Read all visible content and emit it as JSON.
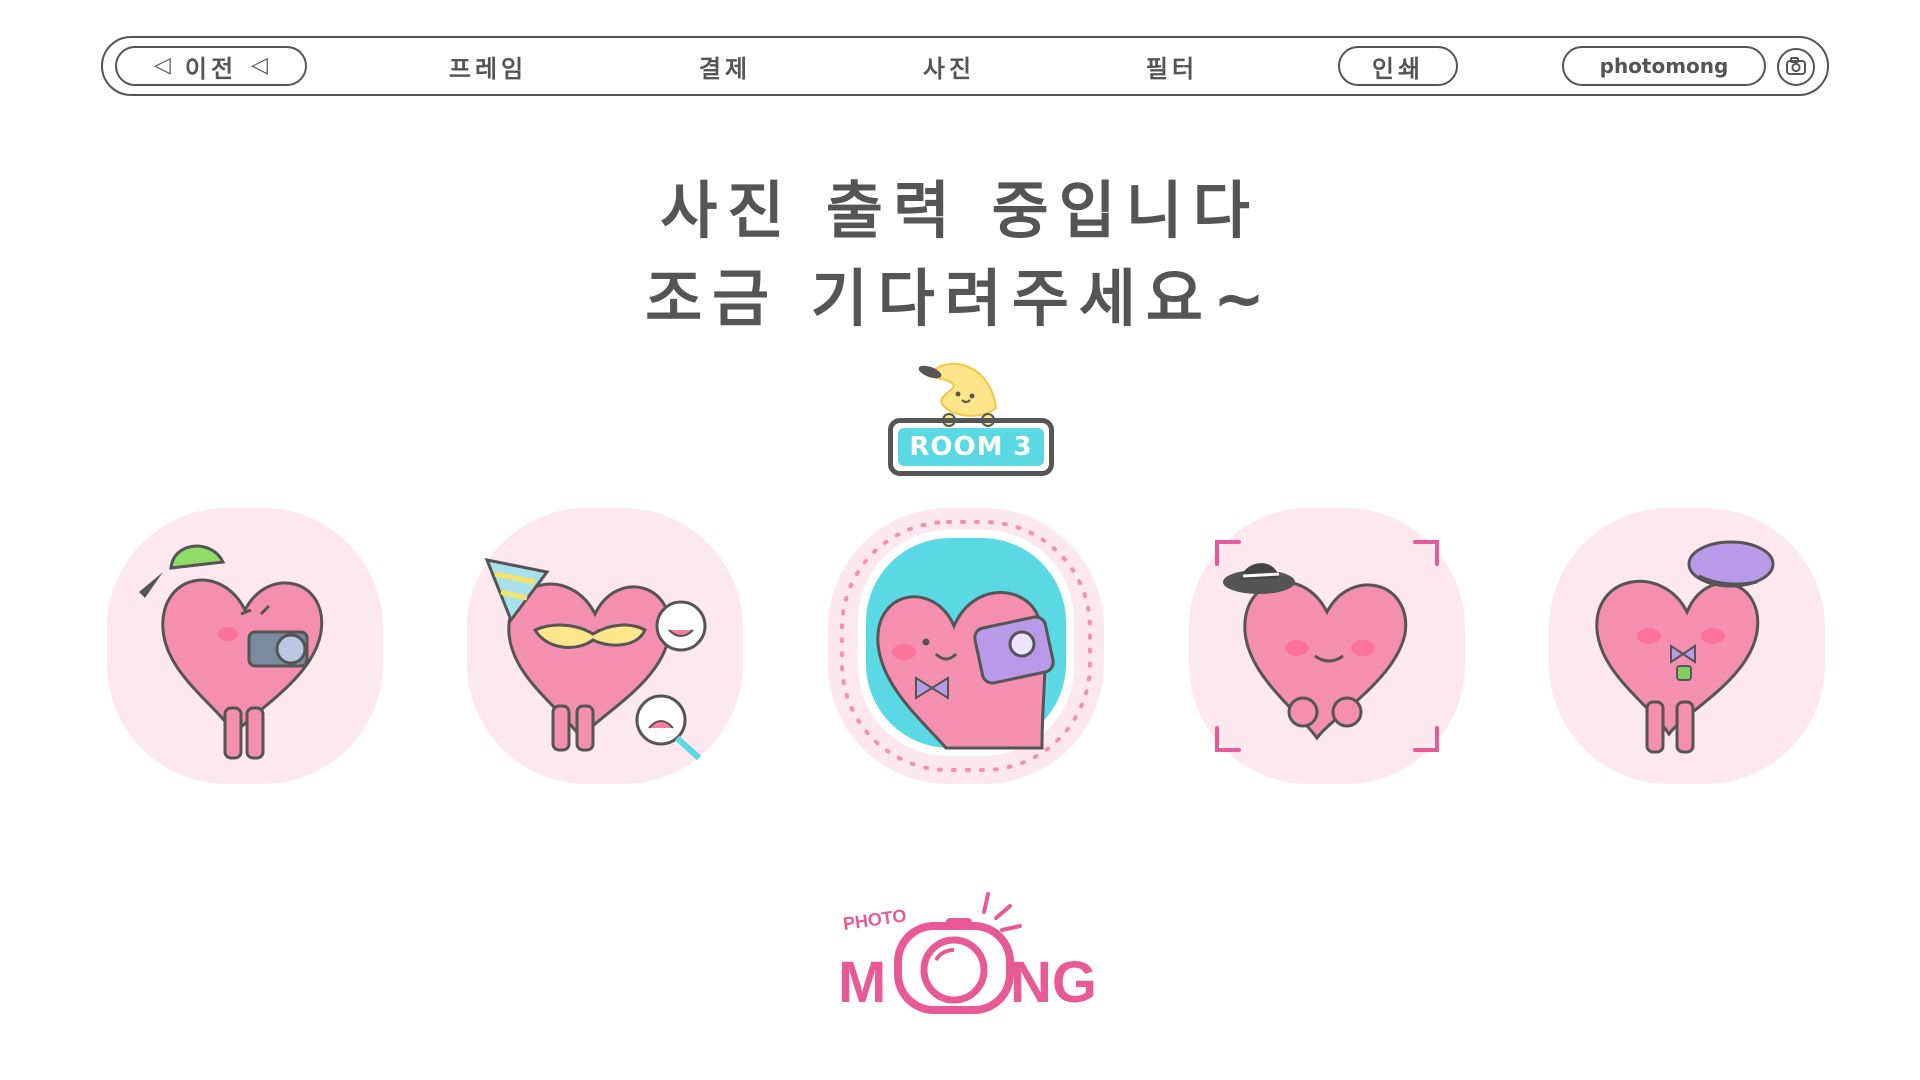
{
  "nav": {
    "back_label": "이전",
    "items": [
      "프레임",
      "결제",
      "사진",
      "필터",
      "인쇄"
    ],
    "brand": "photomong",
    "icons": {
      "back": "back-arrow-icon",
      "camera": "camera-icon"
    }
  },
  "heading": {
    "line1": "사진 출력 중입니다",
    "line2": "조금 기다려주세요~"
  },
  "room": {
    "label": "ROOM 3"
  },
  "cards": [
    {
      "icon": "heart-with-camera-icon"
    },
    {
      "icon": "heart-party-masks-icon"
    },
    {
      "icon": "heart-photo-selected-icon"
    },
    {
      "icon": "heart-hat-frame-icon"
    },
    {
      "icon": "heart-captain-hat-icon"
    }
  ],
  "logo": {
    "top": "PHOTO",
    "main_left": "M",
    "main_right": "NG"
  },
  "colors": {
    "outline": "#555555",
    "heart": "#f57fa4",
    "card_bg": "#fde8ef",
    "accent_cyan": "#5ad8e3",
    "logo_pink": "#e85a96"
  }
}
